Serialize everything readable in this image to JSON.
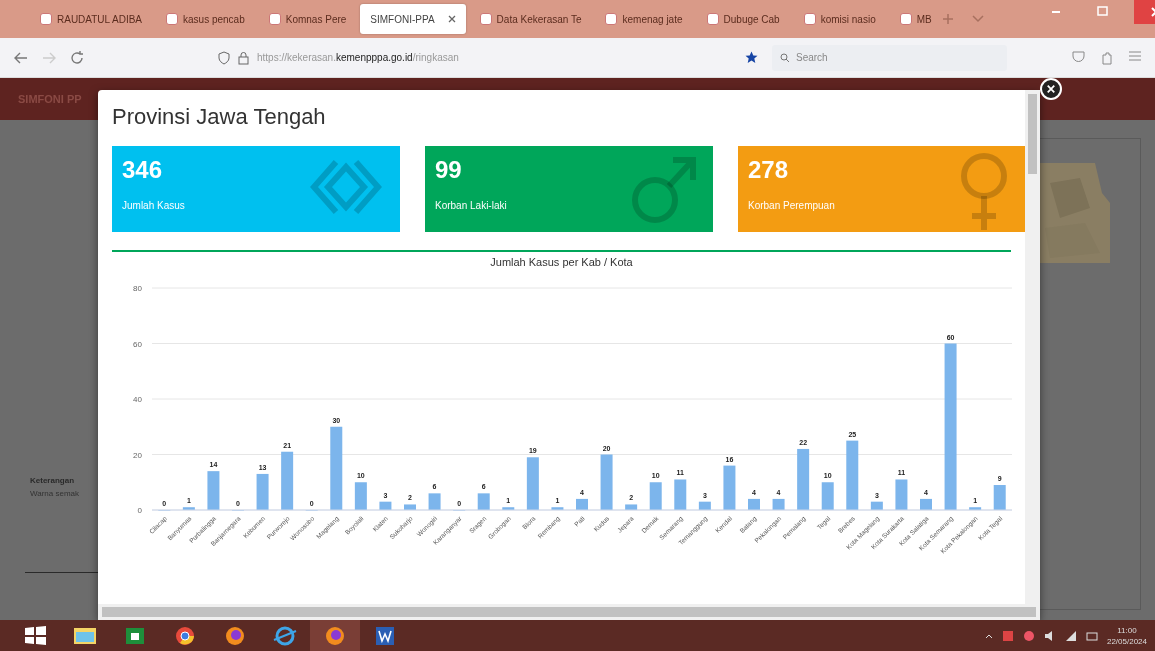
{
  "browser": {
    "tabs": [
      {
        "label": "RAUDATUL ADIBA",
        "selected": false
      },
      {
        "label": "kasus pencab",
        "selected": false
      },
      {
        "label": "Komnas Pere",
        "selected": false
      },
      {
        "label": "SIMFONI-PPA",
        "selected": true
      },
      {
        "label": "Data Kekerasan Te",
        "selected": false
      },
      {
        "label": "kemenag jate",
        "selected": false
      },
      {
        "label": "Dubuge Cab",
        "selected": false
      },
      {
        "label": "komisi nasio",
        "selected": false
      },
      {
        "label": "MB",
        "selected": false
      }
    ],
    "url_prefix": "https://kekerasan.",
    "url_domain": "kemenpppa.go.id",
    "url_path": "/ringkasan",
    "search_placeholder": "Search"
  },
  "background_page": {
    "header": "SIMFONI PP",
    "legend_title": "Keterangan",
    "legend_text": "Warna semak"
  },
  "modal": {
    "title": "Provinsi Jawa Tengah",
    "cards": [
      {
        "value": "346",
        "label": "Jumlah Kasus",
        "color": "#00c0ef",
        "kind": "cases"
      },
      {
        "value": "99",
        "label": "Korban Laki-laki",
        "color": "#00a65a",
        "kind": "male"
      },
      {
        "value": "278",
        "label": "Korban Perempuan",
        "color": "#f39c12",
        "kind": "female"
      }
    ],
    "chart_data": {
      "type": "bar",
      "title": "Jumlah Kasus per Kab / Kota",
      "categories": [
        "Cilacap",
        "Banyumas",
        "Purbalingga",
        "Banjarnegara",
        "Kebumen",
        "Purworejo",
        "Wonosobo",
        "Magelang",
        "Boyolali",
        "Klaten",
        "Sukoharjo",
        "Wonogiri",
        "Karanganyar",
        "Sragen",
        "Grobogan",
        "Blora",
        "Rembang",
        "Pati",
        "Kudus",
        "Jepara",
        "Demak",
        "Semarang",
        "Temanggung",
        "Kendal",
        "Batang",
        "Pekalongan",
        "Pemalang",
        "Tegal",
        "Brebes",
        "Kota Magelang",
        "Kota Surakarta",
        "Kota Salatiga",
        "Kota Semarang",
        "Kota Pekalongan",
        "Kota Tegal"
      ],
      "series": [
        {
          "color": "#7cb5ec",
          "values": [
            0,
            1,
            14,
            0,
            13,
            21,
            0,
            30,
            10,
            3,
            2,
            6,
            0,
            6,
            1,
            19,
            1,
            4,
            20,
            2,
            10,
            11,
            3,
            16,
            4,
            4,
            22,
            10,
            25,
            3,
            11,
            4,
            60,
            1,
            9
          ]
        }
      ],
      "ylim": [
        0,
        80
      ],
      "grid": true,
      "yticks": [
        0,
        20,
        40,
        60,
        80
      ],
      "data_labels": true
    }
  },
  "taskbar": {
    "time": "11:00",
    "date": "22/05/2024"
  }
}
